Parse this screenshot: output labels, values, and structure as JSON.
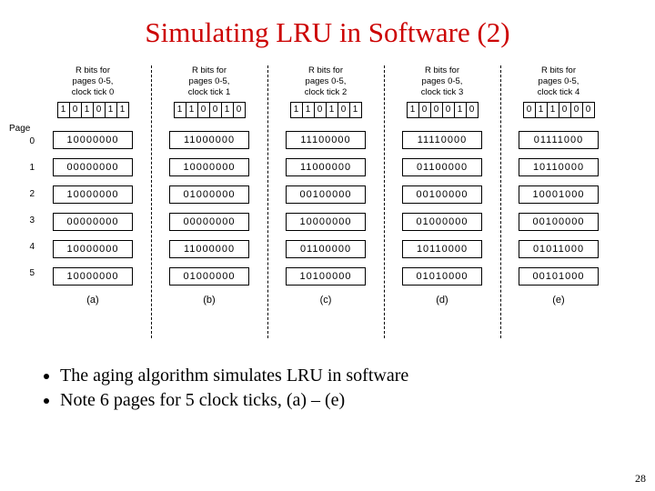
{
  "title": "Simulating LRU in Software (2)",
  "page_label": "Page",
  "columns": [
    {
      "header": "R bits for\npages 0-5,\nclock tick 0",
      "rbits": [
        "1",
        "0",
        "1",
        "0",
        "1",
        "1"
      ],
      "counters": [
        "10000000",
        "00000000",
        "10000000",
        "00000000",
        "10000000",
        "10000000"
      ],
      "label": "(a)"
    },
    {
      "header": "R bits for\npages 0-5,\nclock tick 1",
      "rbits": [
        "1",
        "1",
        "0",
        "0",
        "1",
        "0"
      ],
      "counters": [
        "11000000",
        "10000000",
        "01000000",
        "00000000",
        "11000000",
        "01000000"
      ],
      "label": "(b)"
    },
    {
      "header": "R bits for\npages 0-5,\nclock tick 2",
      "rbits": [
        "1",
        "1",
        "0",
        "1",
        "0",
        "1"
      ],
      "counters": [
        "11100000",
        "11000000",
        "00100000",
        "10000000",
        "01100000",
        "10100000"
      ],
      "label": "(c)"
    },
    {
      "header": "R bits for\npages 0-5,\nclock tick 3",
      "rbits": [
        "1",
        "0",
        "0",
        "0",
        "1",
        "0"
      ],
      "counters": [
        "11110000",
        "01100000",
        "00100000",
        "01000000",
        "10110000",
        "01010000"
      ],
      "label": "(d)"
    },
    {
      "header": "R bits for\npages 0-5,\nclock tick 4",
      "rbits": [
        "0",
        "1",
        "1",
        "0",
        "0",
        "0"
      ],
      "counters": [
        "01111000",
        "10110000",
        "10001000",
        "00100000",
        "01011000",
        "00101000"
      ],
      "label": "(e)"
    }
  ],
  "row_indices": [
    "0",
    "1",
    "2",
    "3",
    "4",
    "5"
  ],
  "bullets": [
    "The aging algorithm simulates LRU in software",
    "Note 6 pages for 5 clock ticks, (a) – (e)"
  ],
  "page_number": "28",
  "chart_data": {
    "type": "table",
    "description": "Aging algorithm counters over 5 clock ticks",
    "ticks": [
      0,
      1,
      2,
      3,
      4
    ],
    "pages": [
      0,
      1,
      2,
      3,
      4,
      5
    ],
    "r_bits_per_tick": [
      [
        1,
        0,
        1,
        0,
        1,
        1
      ],
      [
        1,
        1,
        0,
        0,
        1,
        0
      ],
      [
        1,
        1,
        0,
        1,
        0,
        1
      ],
      [
        1,
        0,
        0,
        0,
        1,
        0
      ],
      [
        0,
        1,
        1,
        0,
        0,
        0
      ]
    ],
    "counters_per_tick": [
      [
        "10000000",
        "00000000",
        "10000000",
        "00000000",
        "10000000",
        "10000000"
      ],
      [
        "11000000",
        "10000000",
        "01000000",
        "00000000",
        "11000000",
        "01000000"
      ],
      [
        "11100000",
        "11000000",
        "00100000",
        "10000000",
        "01100000",
        "10100000"
      ],
      [
        "11110000",
        "01100000",
        "00100000",
        "01000000",
        "10110000",
        "01010000"
      ],
      [
        "01111000",
        "10110000",
        "10001000",
        "00100000",
        "01011000",
        "00101000"
      ]
    ]
  }
}
